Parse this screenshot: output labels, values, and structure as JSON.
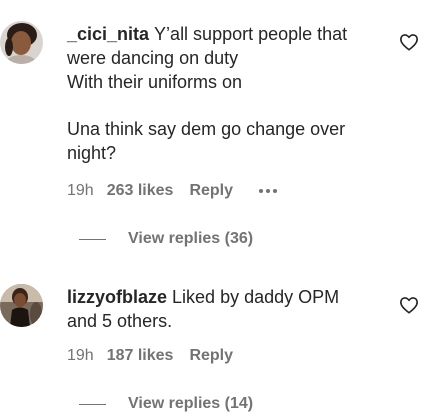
{
  "comments": [
    {
      "username": "_cici_nita",
      "lines": [
        "Y’all support people that",
        "were dancing on duty",
        "With their uniforms on",
        "",
        "Una think say dem go change over",
        "night?"
      ],
      "time": "19h",
      "likes": "263 likes",
      "reply_label": "Reply",
      "view_replies": "View replies (36)",
      "avatar_icon": "user-avatar-woman",
      "like_icon": "heart-outline-icon"
    },
    {
      "username": "lizzyofblaze",
      "lines": [
        "Liked by daddy OPM",
        "and 5 others."
      ],
      "time": "19h",
      "likes": "187 likes",
      "reply_label": "Reply",
      "view_replies": "View replies (14)",
      "avatar_icon": "user-avatar-woman",
      "like_icon": "heart-outline-icon"
    }
  ],
  "colors": {
    "primary_text": "#262626",
    "secondary_text": "#737373"
  }
}
